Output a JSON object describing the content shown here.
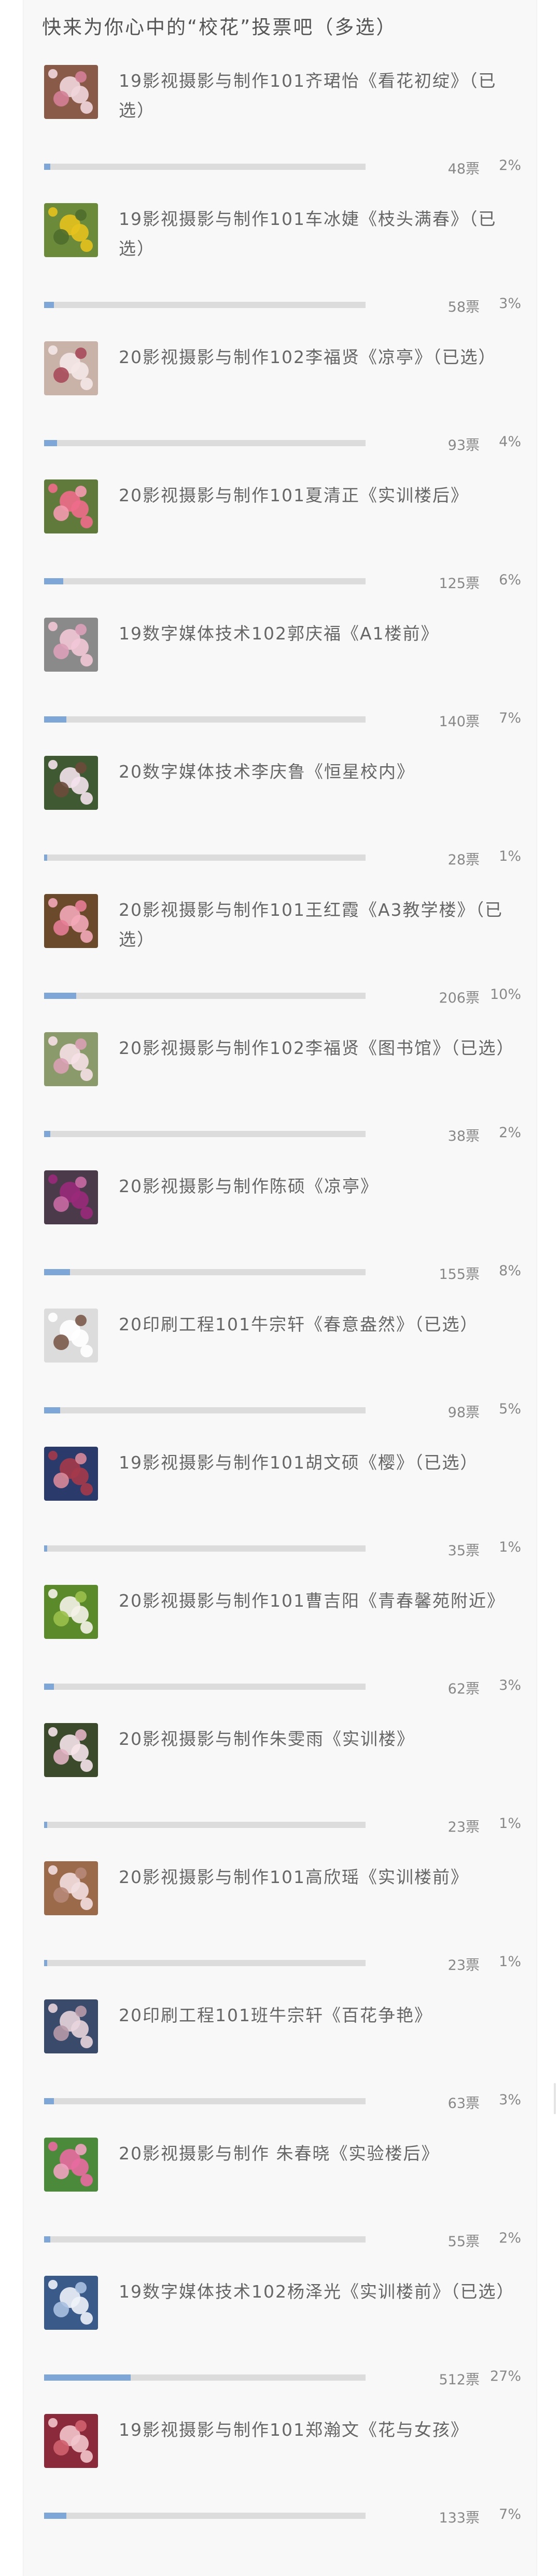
{
  "poll": {
    "heading": "快来为你心中的“校花”投票吧（多选）",
    "items": [
      {
        "title": "19影视摄影与制作101齐珺怡《看花初绽》（已选）",
        "votes": "48票",
        "percent": "2%",
        "fraction": 0.02
      },
      {
        "title": "19影视摄影与制作101车冰婕《枝头满春》（已选）",
        "votes": "58票",
        "percent": "3%",
        "fraction": 0.03
      },
      {
        "title": "20影视摄影与制作102李福贤《凉亭》（已选）",
        "votes": "93票",
        "percent": "4%",
        "fraction": 0.04
      },
      {
        "title": "20影视摄影与制作101夏清正《实训楼后》",
        "votes": "125票",
        "percent": "6%",
        "fraction": 0.06
      },
      {
        "title": "19数字媒体技术102郭庆福《A1楼前》",
        "votes": "140票",
        "percent": "7%",
        "fraction": 0.07
      },
      {
        "title": "20数字媒体技术李庆鲁《恒星校内》",
        "votes": "28票",
        "percent": "1%",
        "fraction": 0.01
      },
      {
        "title": "20影视摄影与制作101王红霞《A3教学楼》（已选）",
        "votes": "206票",
        "percent": "10%",
        "fraction": 0.1
      },
      {
        "title": "20影视摄影与制作102李福贤《图书馆》（已选）",
        "votes": "38票",
        "percent": "2%",
        "fraction": 0.02
      },
      {
        "title": "20影视摄影与制作陈硕《凉亭》",
        "votes": "155票",
        "percent": "8%",
        "fraction": 0.08
      },
      {
        "title": "20印刷工程101牛宗轩《春意盎然》（已选）",
        "votes": "98票",
        "percent": "5%",
        "fraction": 0.05
      },
      {
        "title": "19影视摄影与制作101胡文硕《樱》（已选）",
        "votes": "35票",
        "percent": "1%",
        "fraction": 0.01
      },
      {
        "title": "20影视摄影与制作101曹吉阳《青春馨苑附近》",
        "votes": "62票",
        "percent": "3%",
        "fraction": 0.03
      },
      {
        "title": "20影视摄影与制作朱雯雨《实训楼》",
        "votes": "23票",
        "percent": "1%",
        "fraction": 0.01
      },
      {
        "title": "20影视摄影与制作101高欣瑶《实训楼前》",
        "votes": "23票",
        "percent": "1%",
        "fraction": 0.01
      },
      {
        "title": "20印刷工程101班牛宗轩《百花争艳》",
        "votes": "63票",
        "percent": "3%",
        "fraction": 0.03
      },
      {
        "title": "20影视摄影与制作 朱春晓《实验楼后》",
        "votes": "55票",
        "percent": "2%",
        "fraction": 0.02
      },
      {
        "title": "19数字媒体技术102杨泽光《实训楼前》（已选）",
        "votes": "512票",
        "percent": "27%",
        "fraction": 0.27
      },
      {
        "title": "19影视摄影与制作101郑瀚文《花与女孩》",
        "votes": "133票",
        "percent": "7%",
        "fraction": 0.07
      }
    ]
  },
  "colors": {
    "card_background": "#f8f8f8",
    "bar_track": "#dcdcdc",
    "bar_fill": "#7ea7d8",
    "text": "#666666"
  },
  "thumbnails": [
    {
      "icon": "flower-photo",
      "bg": "#8a5a48",
      "flower": "#f0d6dc",
      "accent": "#d37f96"
    },
    {
      "icon": "flower-photo",
      "bg": "#6b8a3a",
      "flower": "#e6c21e",
      "accent": "#4f6b2c"
    },
    {
      "icon": "flower-photo",
      "bg": "#c9b3a8",
      "flower": "#f3e7e6",
      "accent": "#a84a5a"
    },
    {
      "icon": "flower-photo",
      "bg": "#5f7a3a",
      "flower": "#ee6b8a",
      "accent": "#f49ab0"
    },
    {
      "icon": "flower-photo",
      "bg": "#8a8a8a",
      "flower": "#f2c7d6",
      "accent": "#dba0b8"
    },
    {
      "icon": "flower-photo",
      "bg": "#3f5a33",
      "flower": "#f4e2ec",
      "accent": "#6a4a3a"
    },
    {
      "icon": "flower-photo",
      "bg": "#6a4a2a",
      "flower": "#f3a9b8",
      "accent": "#e57d96"
    },
    {
      "icon": "flower-photo",
      "bg": "#8a9a6a",
      "flower": "#f5e0e6",
      "accent": "#d9a0b4"
    },
    {
      "icon": "flower-photo",
      "bg": "#4a3a4a",
      "flower": "#9a2a7a",
      "accent": "#c86aa4"
    },
    {
      "icon": "flower-photo",
      "bg": "#dcdcdc",
      "flower": "#ffffff",
      "accent": "#7a5a4a"
    },
    {
      "icon": "flower-photo",
      "bg": "#2a3a6a",
      "flower": "#a43a4a",
      "accent": "#d88a9a"
    },
    {
      "icon": "flower-photo",
      "bg": "#5a8a2a",
      "flower": "#f4f2e8",
      "accent": "#9ac04a"
    },
    {
      "icon": "flower-photo",
      "bg": "#3a4a2a",
      "flower": "#f6e4ea",
      "accent": "#e2b4c4"
    },
    {
      "icon": "flower-photo",
      "bg": "#9a6a4a",
      "flower": "#f2dede",
      "accent": "#b88878"
    },
    {
      "icon": "flower-photo",
      "bg": "#3a4a6a",
      "flower": "#e8d4dc",
      "accent": "#b89aa8"
    },
    {
      "icon": "flower-photo",
      "bg": "#4a8a3a",
      "flower": "#e86aa0",
      "accent": "#f0a2c0"
    },
    {
      "icon": "flower-photo",
      "bg": "#3a5a8a",
      "flower": "#eef2f8",
      "accent": "#aac0e0"
    },
    {
      "icon": "flower-photo",
      "bg": "#8a2a3a",
      "flower": "#f2c4cc",
      "accent": "#d0606e"
    }
  ]
}
